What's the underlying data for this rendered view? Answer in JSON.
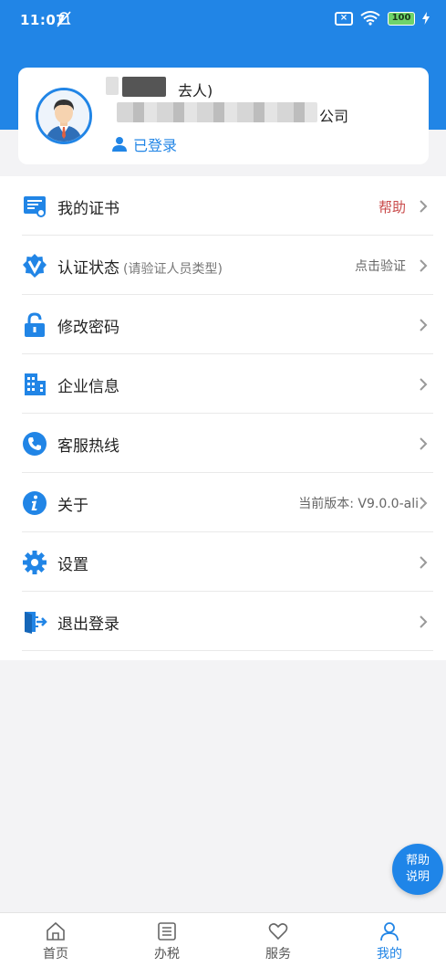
{
  "status_bar": {
    "time": "11:07",
    "battery": "100"
  },
  "profile": {
    "name_visible": "去人)",
    "company_visible": "公司",
    "login_status": "已登录"
  },
  "menu": {
    "items": [
      {
        "label": "我的证书",
        "sub": "",
        "right": "帮助",
        "icon": "certificate-icon"
      },
      {
        "label": "认证状态",
        "sub": "(请验证人员类型)",
        "right": "点击验证",
        "icon": "verified-badge-icon"
      },
      {
        "label": "修改密码",
        "sub": "",
        "right": "",
        "icon": "lock-icon"
      },
      {
        "label": "企业信息",
        "sub": "",
        "right": "",
        "icon": "building-icon"
      },
      {
        "label": "客服热线",
        "sub": "",
        "right": "",
        "icon": "phone-icon"
      },
      {
        "label": "关于",
        "sub": "",
        "right": "当前版本: V9.0.0-ali",
        "icon": "info-icon"
      },
      {
        "label": "设置",
        "sub": "",
        "right": "",
        "icon": "gear-icon"
      },
      {
        "label": "退出登录",
        "sub": "",
        "right": "",
        "icon": "logout-icon"
      }
    ]
  },
  "float_help": {
    "line1": "帮助",
    "line2": "说明"
  },
  "tabbar": {
    "tabs": [
      {
        "label": "首页",
        "icon": "home-icon"
      },
      {
        "label": "办税",
        "icon": "document-icon"
      },
      {
        "label": "服务",
        "icon": "heart-icon"
      },
      {
        "label": "我的",
        "icon": "user-icon"
      }
    ],
    "active": "我的"
  },
  "colors": {
    "accent": "#2185e6",
    "help": "#c94a4a"
  }
}
